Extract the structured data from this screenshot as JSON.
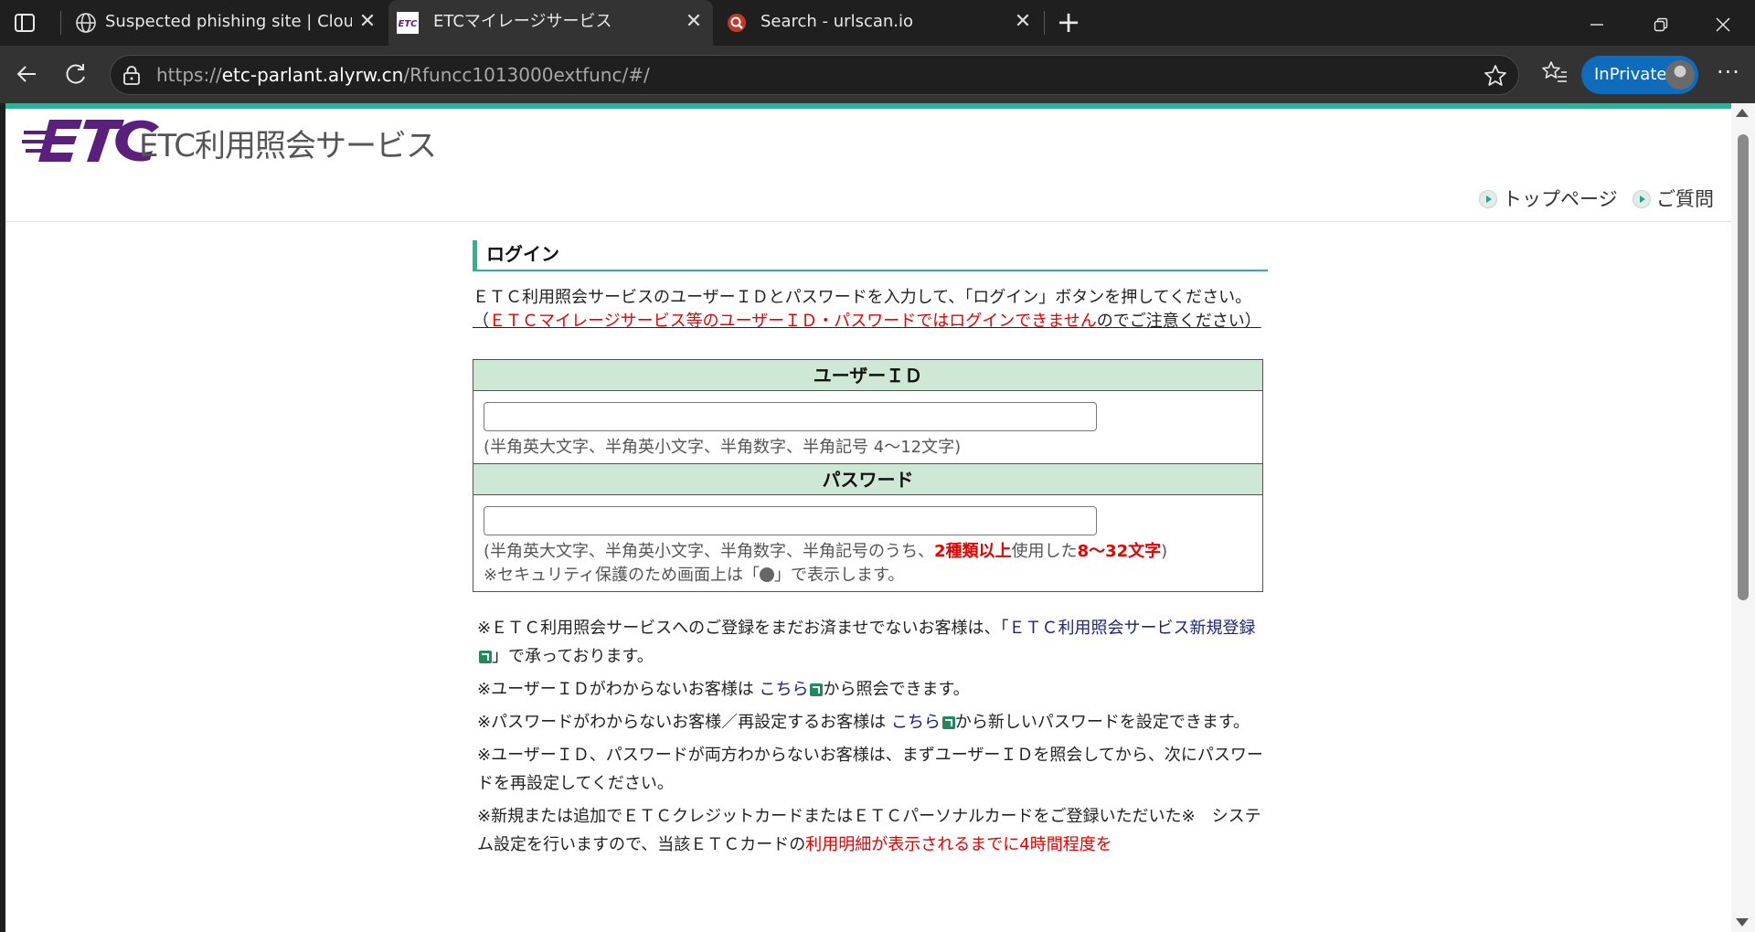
{
  "browser": {
    "tabs": [
      {
        "title": "Suspected phishing site | Cloudfla",
        "favicon": "globe-icon",
        "active": false
      },
      {
        "title": "ETCマイレージサービス",
        "favicon": "etc-logo-icon",
        "active": true
      },
      {
        "title": "Search - urlscan.io",
        "favicon": "urlscan-icon",
        "active": false
      }
    ],
    "address": {
      "scheme": "https://",
      "host": "etc-parlant.alyrw.cn",
      "path": "/Rfuncc1013000extfunc/#/"
    },
    "inprivate_label": "InPrivate",
    "more_label": "···"
  },
  "site": {
    "logo_text": "ETC利用照会サービス",
    "header_links": [
      {
        "label": "トップページ"
      },
      {
        "label": "ご質問"
      }
    ]
  },
  "login": {
    "heading": "ログイン",
    "intro": "ＥＴＣ利用照会サービスのユーザーＩＤとパスワードを入力して、「ログイン」ボタンを押してください。",
    "warning_prefix": "（",
    "warning_red": "ＥＴＣマイレージサービス等のユーザーＩＤ・パスワードではログインできません",
    "warning_suffix": "のでご注意ください）",
    "user_id": {
      "label": "ユーザーＩＤ",
      "value": "",
      "hint": "(半角英大文字、半角英小文字、半角数字、半角記号 4～12文字)"
    },
    "password": {
      "label": "パスワード",
      "value": "",
      "hint_prefix": "(半角英大文字、半角英小文字、半角数字、半角記号のうち、",
      "hint_red1": "2種類以上",
      "hint_mid": "使用した",
      "hint_red2": "8～32文字",
      "hint_suffix": ")",
      "security_prefix": "※セキュリティ保護のため画面上は「",
      "security_suffix": "」で表示します。"
    }
  },
  "notes": {
    "n1_prefix": "※ＥＴＣ利用照会サービスへのご登録をまだお済ませでないお客様は、「",
    "n1_link": "ＥＴＣ利用照会サービス新規登録",
    "n1_suffix": "」で承っております。",
    "n2_prefix": "※ユーザーＩＤがわからないお客様は",
    "n2_link": "こちら",
    "n2_suffix": "から照会できます。",
    "n3_prefix": "※パスワードがわからないお客様／再設定するお客様は",
    "n3_link": "こちら",
    "n3_suffix": "から新しいパスワードを設定できます。",
    "n4": "※ユーザーＩＤ、パスワードが両方わからないお客様は、まずユーザーＩＤを照会してから、次にパスワードを再設定してください。",
    "n5_prefix": "※新規または追加でＥＴＣクレジットカードまたはＥＴＣパーソナルカードをご登録いただいた※　システム設定を行いますので、当該ＥＴＣカードの",
    "n5_red": "利用明細が表示されるまでに4時間程度を"
  },
  "colors": {
    "accent": "#2bb39a",
    "table_header": "#cfe8d6",
    "warning_red": "#e60000",
    "link": "#1a237e",
    "logo_purple": "#5b1f7e"
  }
}
